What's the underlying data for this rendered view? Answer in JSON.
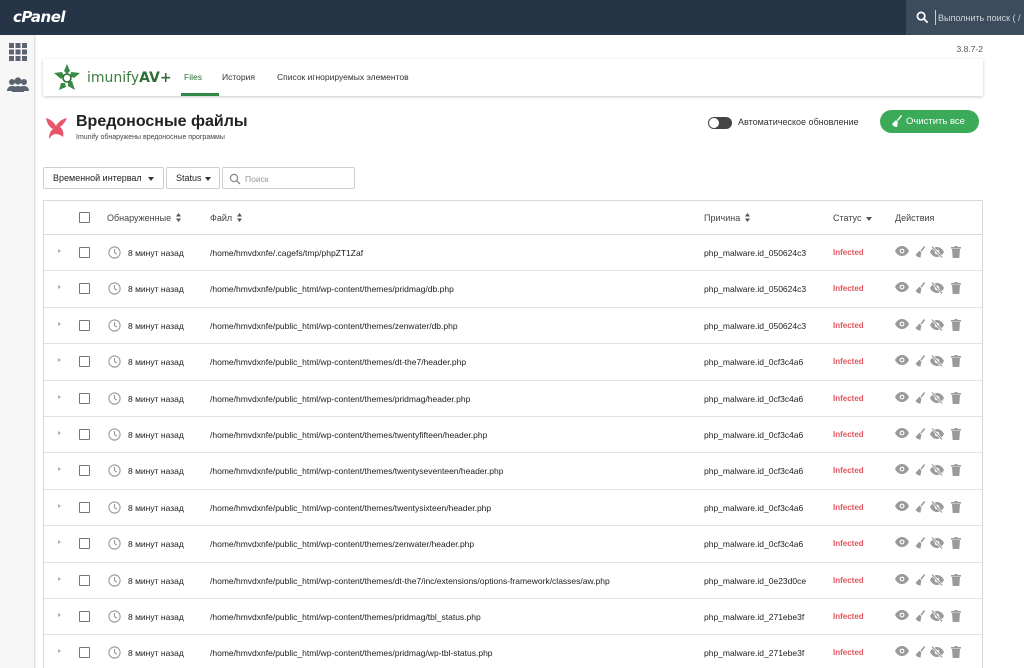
{
  "header": {
    "logo": "cPanel",
    "search_placeholder": "Выполнить поиск ( / )"
  },
  "nav": {
    "icons": [
      "grid-icon",
      "users-icon"
    ]
  },
  "version": "3.8.7-2",
  "brand": {
    "name": "imunify",
    "suffix": "AV+"
  },
  "tabs": [
    {
      "label": "Files",
      "active": true
    },
    {
      "label": "История",
      "active": false
    },
    {
      "label": "Список игнорируемых элементов",
      "active": false
    }
  ],
  "page": {
    "title": "Вредоносные файлы",
    "subtitle": "Imunify обнаружены вредоносные программы",
    "auto_update_label": "Автоматическое обновление",
    "auto_update_enabled": false,
    "clean_all_label": "Очистить все"
  },
  "filters": {
    "time_range_label": "Временной интервал",
    "status_label": "Status",
    "search_placeholder": "Поиск"
  },
  "table": {
    "columns": {
      "detected": "Обнаруженные",
      "file": "Файл",
      "reason": "Причина",
      "status": "Статус",
      "actions": "Действия"
    },
    "rows": [
      {
        "time": "8 минут назад",
        "file": "/home/hmvdxnfe/.cagefs/tmp/phpZT1Zaf",
        "reason": "php_malware.id_050624c3",
        "status": "Infected"
      },
      {
        "time": "8 минут назад",
        "file": "/home/hmvdxnfe/public_html/wp-content/themes/pridmag/db.php",
        "reason": "php_malware.id_050624c3",
        "status": "Infected"
      },
      {
        "time": "8 минут назад",
        "file": "/home/hmvdxnfe/public_html/wp-content/themes/zenwater/db.php",
        "reason": "php_malware.id_050624c3",
        "status": "Infected"
      },
      {
        "time": "8 минут назад",
        "file": "/home/hmvdxnfe/public_html/wp-content/themes/dt-the7/header.php",
        "reason": "php_malware.id_0cf3c4a6",
        "status": "Infected"
      },
      {
        "time": "8 минут назад",
        "file": "/home/hmvdxnfe/public_html/wp-content/themes/pridmag/header.php",
        "reason": "php_malware.id_0cf3c4a6",
        "status": "Infected"
      },
      {
        "time": "8 минут назад",
        "file": "/home/hmvdxnfe/public_html/wp-content/themes/twentyfifteen/header.php",
        "reason": "php_malware.id_0cf3c4a6",
        "status": "Infected"
      },
      {
        "time": "8 минут назад",
        "file": "/home/hmvdxnfe/public_html/wp-content/themes/twentyseventeen/header.php",
        "reason": "php_malware.id_0cf3c4a6",
        "status": "Infected"
      },
      {
        "time": "8 минут назад",
        "file": "/home/hmvdxnfe/public_html/wp-content/themes/twentysixteen/header.php",
        "reason": "php_malware.id_0cf3c4a6",
        "status": "Infected"
      },
      {
        "time": "8 минут назад",
        "file": "/home/hmvdxnfe/public_html/wp-content/themes/zenwater/header.php",
        "reason": "php_malware.id_0cf3c4a6",
        "status": "Infected"
      },
      {
        "time": "8 минут назад",
        "file": "/home/hmvdxnfe/public_html/wp-content/themes/dt-the7/inc/extensions/options-framework/classes/aw.php",
        "reason": "php_malware.id_0e23d0ce",
        "status": "Infected"
      },
      {
        "time": "8 минут назад",
        "file": "/home/hmvdxnfe/public_html/wp-content/themes/pridmag/tbl_status.php",
        "reason": "php_malware.id_271ebe3f",
        "status": "Infected"
      },
      {
        "time": "8 минут назад",
        "file": "/home/hmvdxnfe/public_html/wp-content/themes/pridmag/wp-tbl-status.php",
        "reason": "php_malware.id_271ebe3f",
        "status": "Infected"
      }
    ],
    "row_actions": [
      "eye-icon",
      "broom-icon",
      "eye-slash-icon",
      "trash-icon"
    ]
  },
  "colors": {
    "topbar": "#253446",
    "accent_green": "#3bab5a",
    "infected_red": "#e2565f",
    "brand_pink": "#e8566a"
  }
}
